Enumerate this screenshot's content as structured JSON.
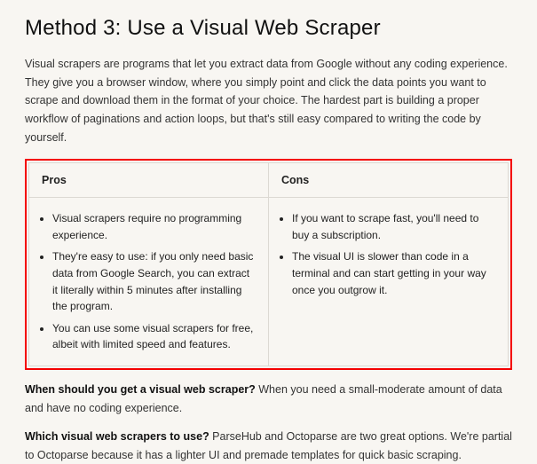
{
  "heading": "Method 3: Use a Visual Web Scraper",
  "intro": "Visual scrapers are programs that let you extract data from Google without any coding experience. They give you a browser window, where you simply point and click the data points you want to scrape and download them in the format of your choice. The hardest part is building a proper workflow of paginations and action loops, but that's still easy compared to writing the code by yourself.",
  "table": {
    "headers": {
      "pros": "Pros",
      "cons": "Cons"
    },
    "pros": [
      "Visual scrapers require no programming experience.",
      "They're easy to use: if you only need basic data from Google Search, you can extract it literally within 5 minutes after installing the program.",
      "You can use some visual scrapers for free, albeit with limited speed and features."
    ],
    "cons": [
      "If you want to scrape fast, you'll need to buy a subscription.",
      "The visual UI is slower than code in a terminal and can start getting in your way once you outgrow it."
    ]
  },
  "followup1": {
    "lead": "When should you get a visual web scraper?",
    "rest": " When you need a small-moderate amount of data and have no coding experience."
  },
  "followup2": {
    "lead": "Which visual web scrapers to use?",
    "rest": " ParseHub and Octoparse are two great options. We're partial to Octoparse because it has a lighter UI and premade templates for quick basic scraping."
  }
}
